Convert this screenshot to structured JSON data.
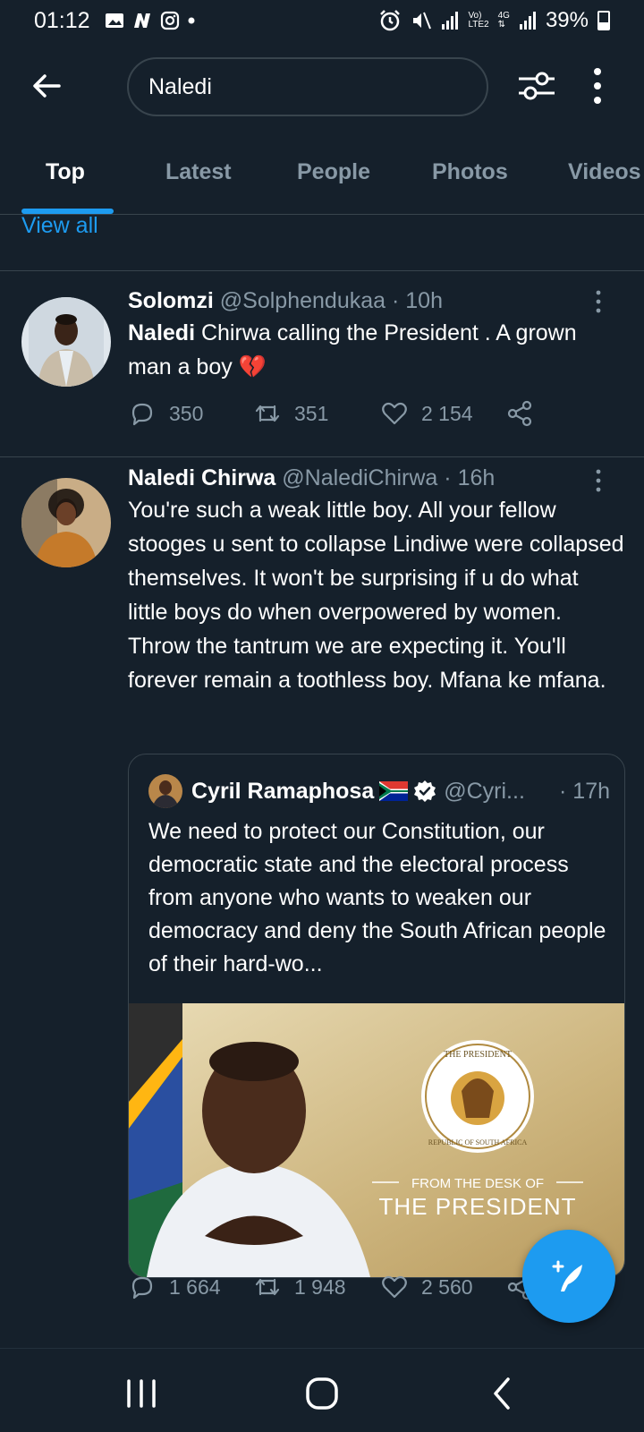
{
  "status_bar": {
    "time": "01:12",
    "network_label_top": "Vo)",
    "network_label_bottom": "LTE2",
    "network_type": "4G",
    "battery": "39%"
  },
  "search": {
    "query": "Naledi"
  },
  "tabs": [
    {
      "label": "Top",
      "active": true
    },
    {
      "label": "Latest",
      "active": false
    },
    {
      "label": "People",
      "active": false
    },
    {
      "label": "Photos",
      "active": false
    },
    {
      "label": "Videos",
      "active": false
    }
  ],
  "view_all": "View all",
  "tweets": [
    {
      "name": "Solomzi",
      "handle": "@Solphendukaa",
      "time": "· 10h",
      "text_bold": "Naledi",
      "text_rest": " Chirwa calling the President . A grown man a boy 💔",
      "replies": "350",
      "retweets": "351",
      "likes": "2 154"
    },
    {
      "name": "Naledi Chirwa",
      "handle": "@NalediChirwa",
      "time": "· 16h",
      "text": "You're such a weak little boy. All your fellow stooges u sent to collapse Lindiwe were collapsed themselves. It won't be surprising if u do what little boys do when overpowered by women. Throw the tantrum we are expecting it. You'll forever remain a toothless boy. Mfana ke mfana.",
      "replies": "1 664",
      "retweets": "1 948",
      "likes": "2 560",
      "quote": {
        "name": "Cyril Ramaphosa",
        "handle": "@Cyri...",
        "time": "· 17h",
        "text": "We need to protect our Constitution, our democratic state and the electoral process from anyone who wants to weaken our democracy and deny the South African people of their hard-wo...",
        "image": {
          "seal_text_top": "THE PRESIDENT",
          "seal_text_bottom": "REPUBLIC OF SOUTH AFRICA",
          "caption_small": "FROM THE DESK OF",
          "caption_large": "THE PRESIDENT"
        }
      }
    }
  ],
  "colors": {
    "background": "#15202b",
    "accent": "#1d9bf0",
    "secondary_text": "#8899a6",
    "border": "#38444d"
  }
}
